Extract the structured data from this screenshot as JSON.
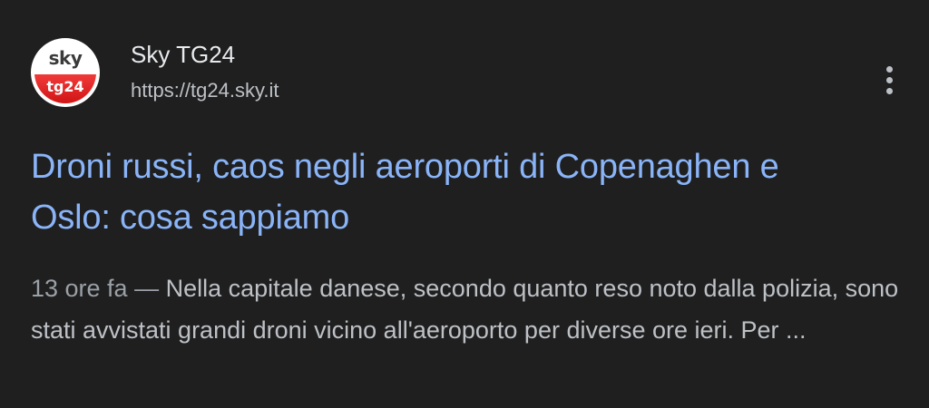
{
  "result": {
    "source": {
      "logo_top_text": "sky",
      "logo_bottom_text": "tg24",
      "name": "Sky TG24",
      "url": "https://tg24.sky.it",
      "menu_icon": "more-vert-icon"
    },
    "headline": "Droni russi, caos negli aeroporti di Copenaghen e Oslo: cosa sappiamo",
    "snippet": {
      "time": "13 ore fa",
      "separator": " — ",
      "text": "Nella capitale danese, secondo quanto reso noto dalla polizia, sono stati avvistati grandi droni vicino all'aeroporto per diverse ore ieri. Per ..."
    }
  },
  "colors": {
    "background": "#1f1f1f",
    "headline_link": "#8ab4f8",
    "primary_text": "#e8eaed",
    "secondary_text": "#bdc1c6",
    "logo_red": "#e02020"
  }
}
